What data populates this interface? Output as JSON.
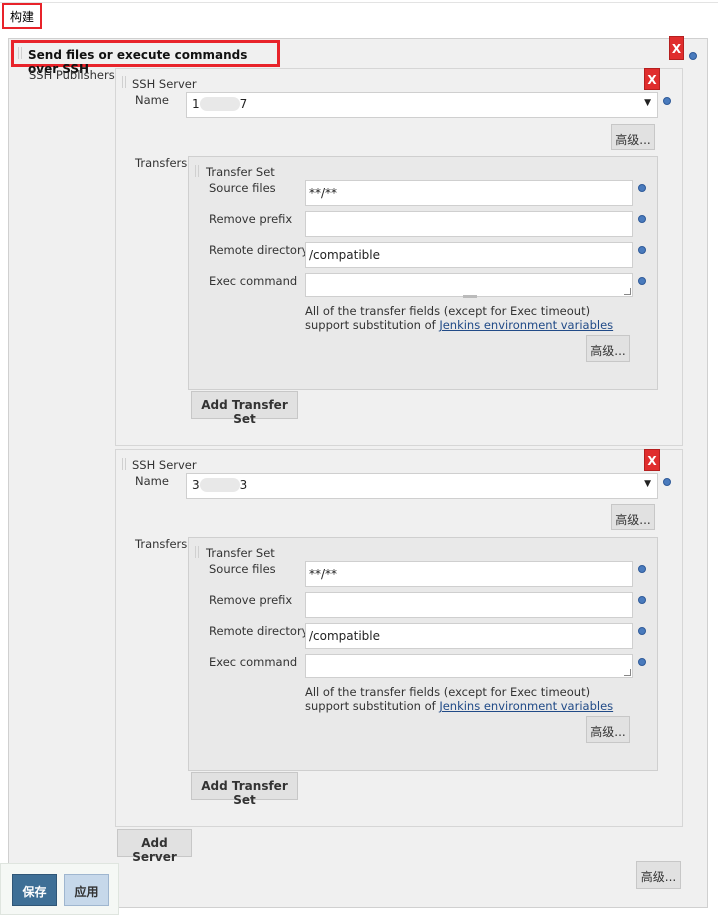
{
  "section": {
    "title": "构建"
  },
  "builder": {
    "title": "Send files or execute commands over SSH",
    "publishers_label": "SSH Publishers",
    "delete_label": "X",
    "add_server_label": "Add Server",
    "advanced_label": "高级..."
  },
  "servers": [
    {
      "header": "SSH Server",
      "name_label": "Name",
      "name_value_prefix": "1",
      "name_value_suffix": "7",
      "advanced_label": "高级...",
      "transfers_label": "Transfers",
      "transfer_set": {
        "header": "Transfer Set",
        "source_files_label": "Source files",
        "source_files_value": "**/**",
        "remove_prefix_label": "Remove prefix",
        "remove_prefix_value": "",
        "remote_directory_label": "Remote directory",
        "remote_directory_value": "/compatible",
        "exec_command_label": "Exec command",
        "hint_text": "All of the transfer fields (except for Exec timeout) support substitution of",
        "hint_link": "Jenkins environment variables",
        "advanced_label": "高级..."
      },
      "add_transfer_set_label": "Add Transfer Set"
    },
    {
      "header": "SSH Server",
      "name_label": "Name",
      "name_value_prefix": "3",
      "name_value_suffix": "3",
      "advanced_label": "高级...",
      "transfers_label": "Transfers",
      "transfer_set": {
        "header": "Transfer Set",
        "source_files_label": "Source files",
        "source_files_value": "**/**",
        "remove_prefix_label": "Remove prefix",
        "remove_prefix_value": "",
        "remote_directory_label": "Remote directory",
        "remote_directory_value": "/compatible",
        "exec_command_label": "Exec command",
        "hint_text": "All of the transfer fields (except for Exec timeout) support substitution of",
        "hint_link": "Jenkins environment variables",
        "advanced_label": "高级..."
      },
      "add_transfer_set_label": "Add Transfer Set"
    }
  ],
  "footer": {
    "save_label": "保存",
    "apply_label": "应用"
  },
  "colors": {
    "highlight": "#e8232a",
    "delete": "#e02d2d",
    "save": "#3e6f96",
    "link": "#204a87"
  }
}
